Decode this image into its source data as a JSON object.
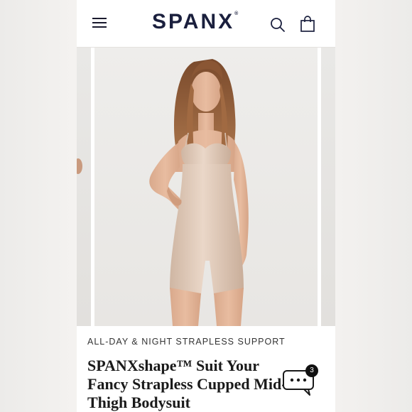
{
  "header": {
    "logo_text": "SPANX",
    "logo_mark": "®",
    "menu_icon": "hamburger-menu-icon",
    "search_icon": "search-icon",
    "bag_icon": "shopping-bag-icon"
  },
  "product": {
    "eyebrow": "ALL-DAY & NIGHT STRAPLESS SUPPORT",
    "title": "SPANXshape™ Suit Your Fancy Strapless Cupped Mid-Thigh Bodysuit",
    "image": "model wearing nude strapless cupped mid-thigh bodysuit"
  },
  "chat": {
    "icon": "chat-bubble-icon",
    "badge_count": "3"
  },
  "colors": {
    "brand_navy": "#1a1f3d",
    "product_nude": "#dcc3b0",
    "background": "#ffffff"
  }
}
